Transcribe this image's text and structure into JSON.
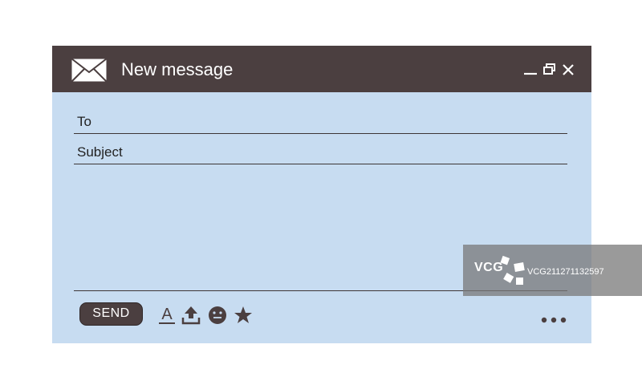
{
  "window": {
    "title": "New message",
    "colors": {
      "titlebar": "#4b3f40",
      "body": "#c7dcf1",
      "text": "#222222"
    },
    "controls": [
      "minimize-icon",
      "restore-icon",
      "close-icon"
    ]
  },
  "fields": {
    "to_label": "To",
    "subject_label": "Subject"
  },
  "toolbar": {
    "send_label": "SEND",
    "icons": [
      "format-text-icon",
      "upload-icon",
      "emoji-icon",
      "star-icon"
    ],
    "more": "more-options-icon"
  },
  "watermark": {
    "logo": "VCG",
    "text": "VCG211271132597"
  }
}
